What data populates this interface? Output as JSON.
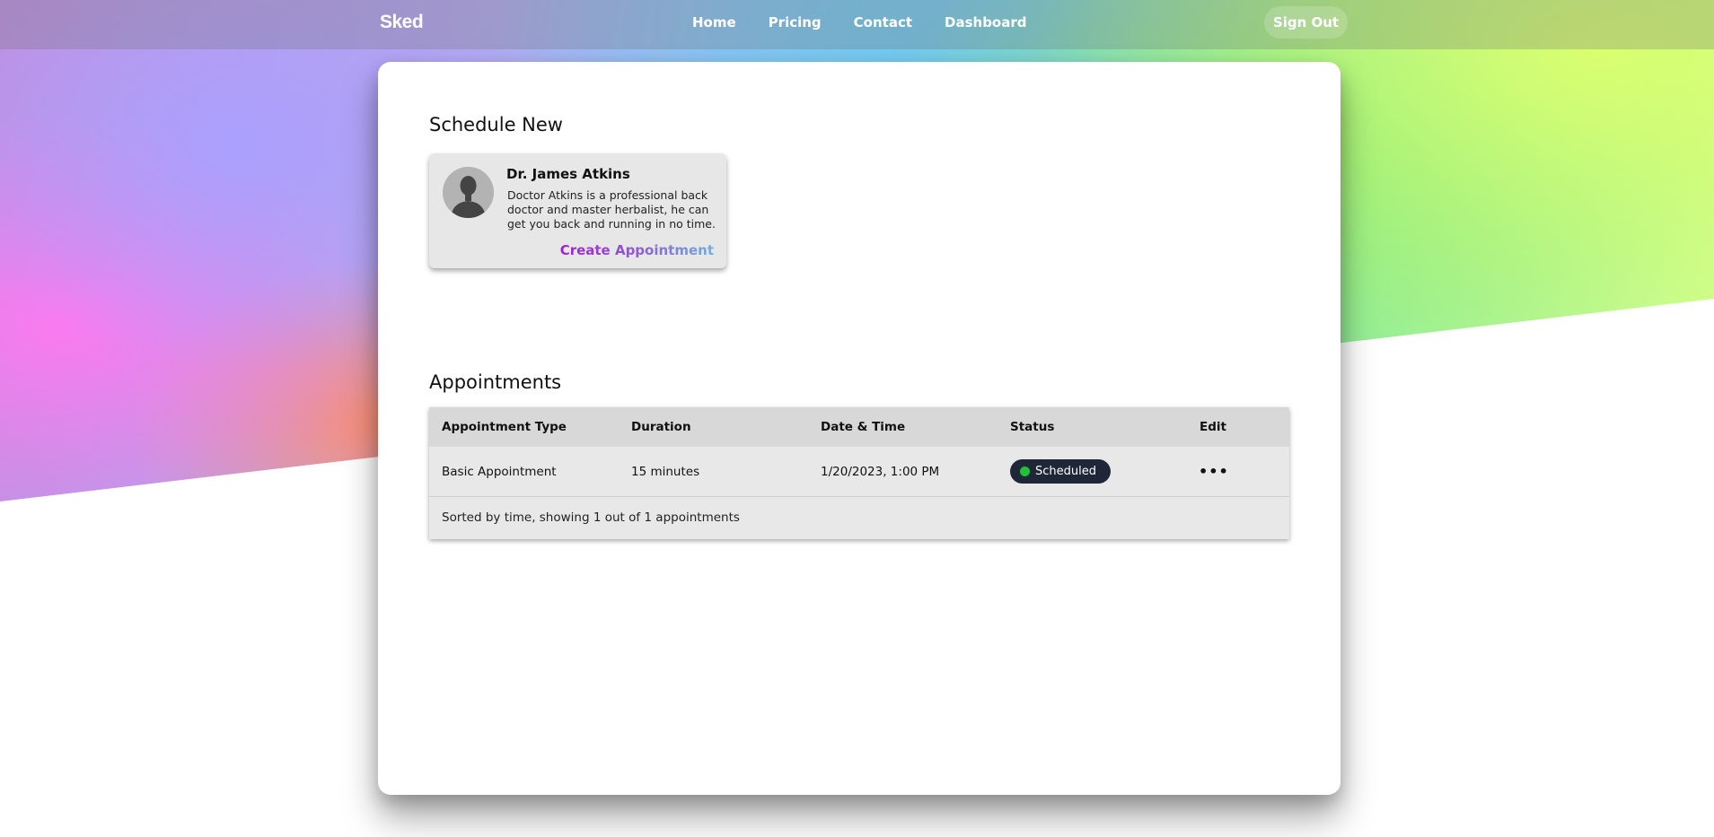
{
  "nav": {
    "logo": "Sked",
    "links": [
      "Home",
      "Pricing",
      "Contact",
      "Dashboard"
    ],
    "sign_out": "Sign Out"
  },
  "schedule": {
    "title": "Schedule New",
    "doctor": {
      "name": "Dr. James Atkins",
      "description": "Doctor Atkins is a professional back doctor and master herbalist, he can get you back and running in no time.",
      "avatar_icon": "person-silhouette-icon",
      "action": "Create Appointment"
    }
  },
  "appointments": {
    "title": "Appointments",
    "columns": [
      "Appointment Type",
      "Duration",
      "Date & Time",
      "Status",
      "Edit"
    ],
    "rows": [
      {
        "type": "Basic Appointment",
        "duration": "15 minutes",
        "datetime": "1/20/2023, 1:00 PM",
        "status": "Scheduled",
        "status_color": "#22c03a",
        "edit_icon": "more-horizontal-icon"
      }
    ],
    "footer": "Sorted by time, showing 1 out of 1 appointments"
  }
}
